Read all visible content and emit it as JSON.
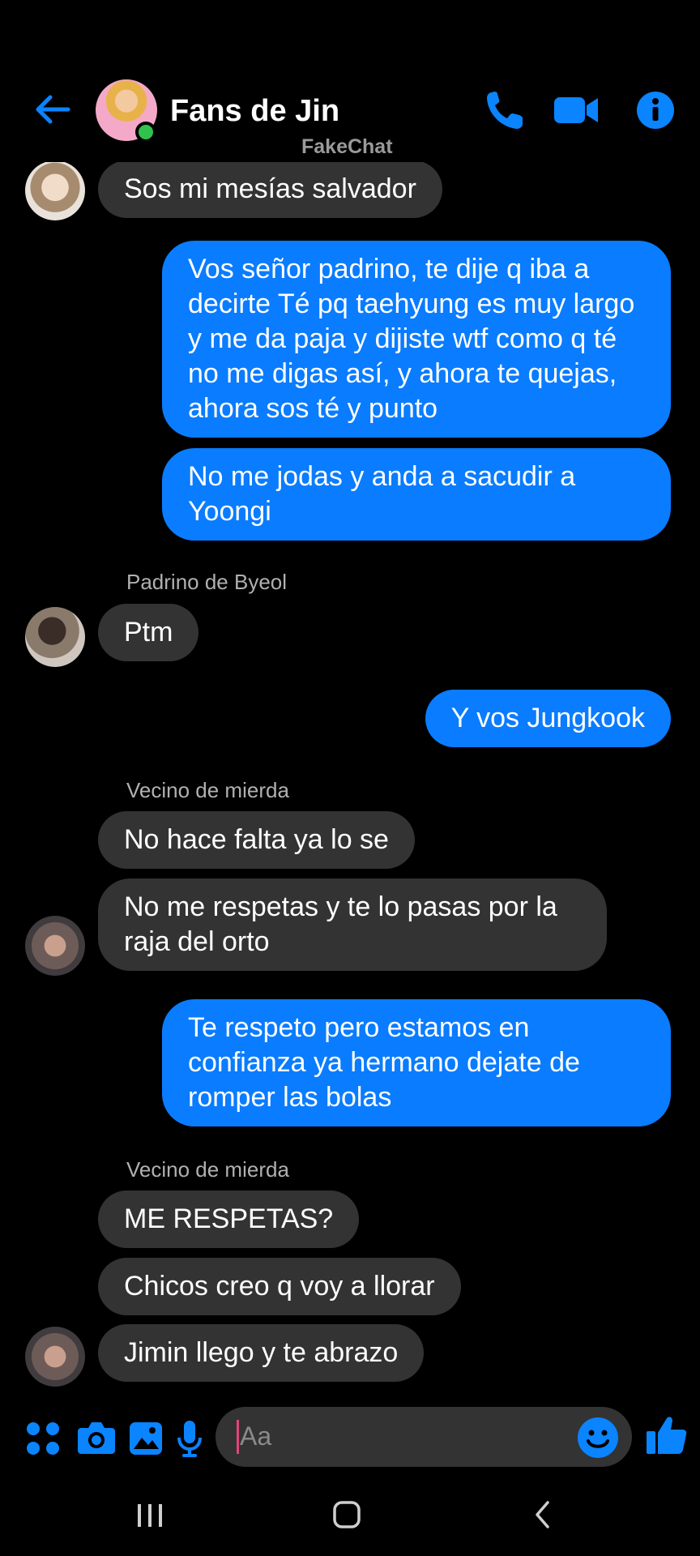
{
  "header": {
    "title": "Fans de Jin",
    "watermark": "FakeChat",
    "colors": {
      "accent": "#0a84ff",
      "online": "#31c24d"
    }
  },
  "messages": [
    {
      "direction": "in",
      "text": "Sos mi mesías salvador"
    },
    {
      "direction": "out",
      "text": "Vos señor padrino, te dije q iba a decirte Té pq taehyung es muy largo y me da paja y dijiste wtf como q té no me digas así, y ahora te quejas, ahora sos té y punto"
    },
    {
      "direction": "out",
      "text": "No me jodas y anda a sacudir a Yoongi"
    },
    {
      "sender": "Padrino de Byeol",
      "direction": "in",
      "text": "Ptm"
    },
    {
      "direction": "out",
      "text": "Y vos Jungkook"
    },
    {
      "sender": "Vecino de mierda",
      "direction": "in",
      "text": "No hace falta ya lo se"
    },
    {
      "direction": "in",
      "text": "No me respetas y te lo pasas por la raja del orto"
    },
    {
      "direction": "out",
      "text": "Te respeto pero estamos en confianza ya hermano dejate de romper las bolas"
    },
    {
      "sender": "Vecino de mierda",
      "direction": "in",
      "text": "ME RESPETAS?"
    },
    {
      "direction": "in",
      "text": "Chicos creo q voy a llorar"
    },
    {
      "direction": "in",
      "text": "Jimin llego y te abrazo"
    }
  ],
  "senders": [
    "Padrino de Byeol",
    "Vecino de mierda",
    "Vecino de mierda"
  ],
  "composer": {
    "placeholder": "Aa",
    "icons": [
      "apps-icon",
      "camera-icon",
      "gallery-icon",
      "microphone-icon",
      "emoji-icon",
      "thumbs-up-icon"
    ]
  },
  "navbar": {
    "icons": [
      "recent-apps-icon",
      "home-icon",
      "back-icon"
    ]
  }
}
